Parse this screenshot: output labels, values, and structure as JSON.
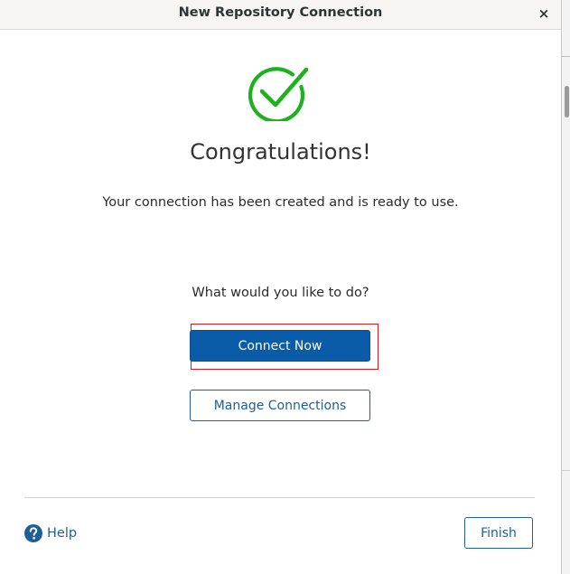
{
  "window": {
    "title": "New Repository Connection",
    "close_label": "×"
  },
  "content": {
    "heading": "Congratulations!",
    "message": "Your connection has been created and is ready to use.",
    "question": "What would you like to do?"
  },
  "actions": {
    "connect_now_label": "Connect Now",
    "manage_connections_label": "Manage Connections"
  },
  "footer": {
    "help_label": "Help",
    "finish_label": "Finish"
  },
  "icons": {
    "success": "check-circle-icon",
    "help": "question-circle-icon",
    "close": "close-icon"
  },
  "colors": {
    "success_green": "#1db11d",
    "primary_blue": "#0a5ba8",
    "link_blue": "#1f5f96",
    "focus_red": "#d11a1a"
  }
}
